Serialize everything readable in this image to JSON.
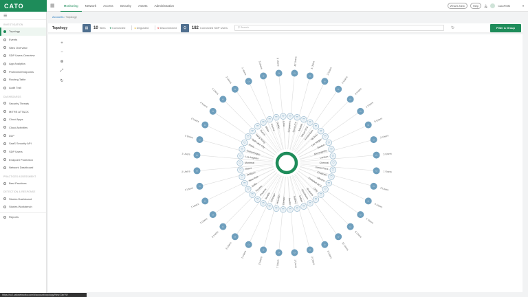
{
  "logo": "CATO",
  "nav": {
    "tabs": [
      "Monitoring",
      "Network",
      "Access",
      "Security",
      "Assets",
      "Administration"
    ],
    "whats_new": "What's New",
    "help": "Help",
    "user": "CatoPMM"
  },
  "sidebar": {
    "sections": [
      {
        "title": "INVESTIGATION",
        "items": [
          "Topology",
          "Events",
          "Sites Overview",
          "SDP Users Overview",
          "App Analytics",
          "Protected Endpoints",
          "Routing Table",
          "Audit Trail"
        ]
      },
      {
        "title": "DASHBOARDS",
        "items": [
          "Security Threats",
          "MITRE ATT&CK",
          "Cloud Apps",
          "Cloud Activities",
          "DLP",
          "SaaS Security API",
          "SDP Users",
          "Endpoint Protection",
          "Network Dashboard"
        ]
      },
      {
        "title": "PRACTICES ASSESSMENT",
        "items": [
          "Best Practices"
        ]
      },
      {
        "title": "DETECTION & RESPONSE",
        "items": [
          "Stories Dashboard",
          "Stories Workbench"
        ]
      },
      {
        "title": "",
        "items": [
          "Reports"
        ]
      }
    ]
  },
  "breadcrumb": {
    "parent": "Accounts",
    "sep": "/",
    "current": "Topology"
  },
  "toolbar": {
    "title": "Topology",
    "sites_count": "10",
    "sites_label": "Sites",
    "connected_count": "9",
    "connected_label": "Connected",
    "degraded_count": "1",
    "degraded_label": "Degraded",
    "disconnected_count": "0",
    "disconnected_label": "Disconnected",
    "sdp_count": "182",
    "sdp_label": "Connected SDP Users",
    "search_placeholder": "Search",
    "filter_label": "Filter & Group"
  },
  "zoom_controls": [
    "+",
    "−",
    "⊕",
    "⤢",
    "↻"
  ],
  "status_url": "https://cc2.catonetworks.com/#/account/topology/New-Tab?W",
  "colors": {
    "brand": "#1e8c5a",
    "node": "#6f9fbd",
    "connected": "#1e8c5a",
    "degraded": "#f0b400",
    "disconnected": "#e03c3c"
  },
  "topology": {
    "sites": [
      "Singapore",
      "Seoul-CX",
      "Madrid",
      "Tokyo DC2",
      "Amsterdam",
      "Tel Aviv",
      "Las Vegas",
      "Boston",
      "Minneapolis",
      "London",
      "Chennai",
      "Santa Clara",
      "Charlotte",
      "Mexico",
      "Frankfurt DC2",
      "Oslo",
      "Brussels",
      "Stockholm",
      "Dallas",
      "Sydney",
      "Austin",
      "Denver",
      "Houston",
      "Chicago",
      "Seattle",
      "Phoenix",
      "Toronto",
      "Sofia",
      "New York",
      "Ashburn",
      "Miami",
      "Montreal",
      "Los Angeles",
      "Copenhagen",
      "Paris",
      "Salt Lake City",
      "Hong Kong",
      "Zurich",
      "Milan",
      "Vienna",
      "Dublin",
      "Lima"
    ],
    "user_groups": [
      "42 Users",
      "1 Users",
      "3 Users",
      "6 Users",
      "3 Users",
      "1 Users",
      "8 Users",
      "2 Users",
      "3 Users",
      "1 Users",
      "2 Users",
      "4 Users",
      "1 Users",
      "5 Users",
      "12 Users",
      "3 Users",
      "2 Users",
      "1 Users",
      "7 Users",
      "2 Users",
      "1 Users",
      "3 Users",
      "5 Users",
      "2 Users",
      "1 Users",
      "4 Users",
      "2 Users",
      "1 Users",
      "3 Users",
      "2 Users",
      "4 Users",
      "1 Users",
      "2 Users",
      "1 Users",
      "5 Users",
      "9 Users"
    ]
  }
}
